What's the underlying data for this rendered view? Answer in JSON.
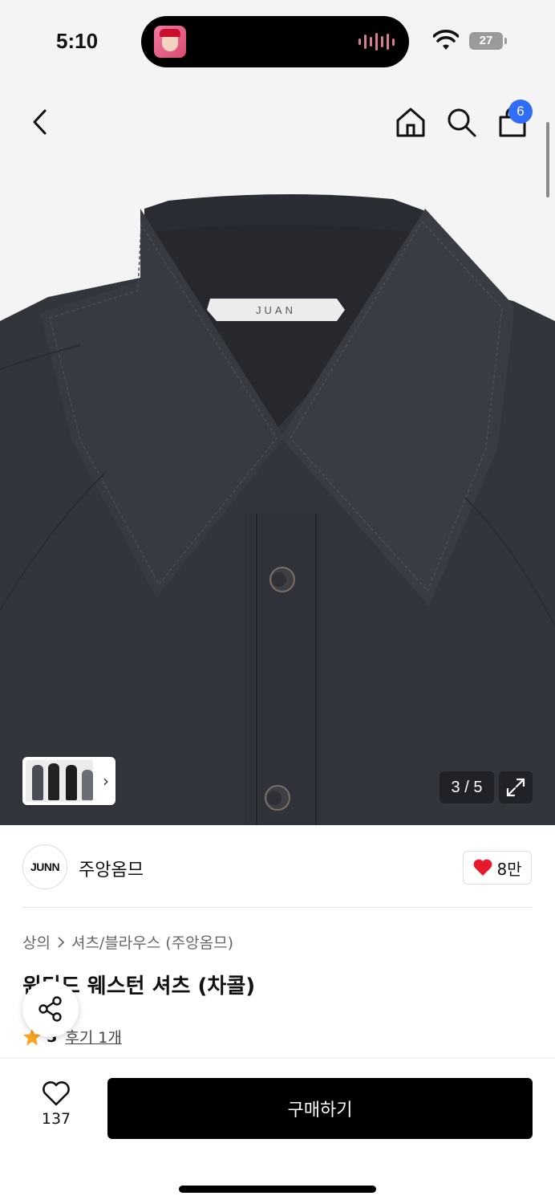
{
  "status_bar": {
    "time": "5:10",
    "battery": "27",
    "icons": [
      "wifi-icon",
      "battery-icon",
      "audio-waveform-icon"
    ]
  },
  "top_nav": {
    "icons": [
      "back-chevron-icon",
      "home-icon",
      "search-icon",
      "shopping-bag-icon"
    ],
    "cart_count": "6"
  },
  "gallery": {
    "label_text": "JUAN",
    "page_indicator": "3 / 5",
    "current_page": 3,
    "total_pages": 5,
    "shirt_color": "#33353c"
  },
  "brand": {
    "logo_text": "JUNN",
    "name": "주앙옴므",
    "like_count": "8만"
  },
  "product": {
    "breadcrumb": [
      "상의",
      "셔츠/블라우스 (주앙옴므)"
    ],
    "title": "윈디드 웨스턴 셔츠 (차콜)",
    "rating": "5",
    "reviews": "후기 1개"
  },
  "bottom_bar": {
    "wish_count": "137",
    "buy_label": "구매하기"
  },
  "colors": {
    "accent_blue": "#2f6df6",
    "heart_red": "#e8192c",
    "star_orange": "#f5a623",
    "buy_button": "#000000"
  }
}
